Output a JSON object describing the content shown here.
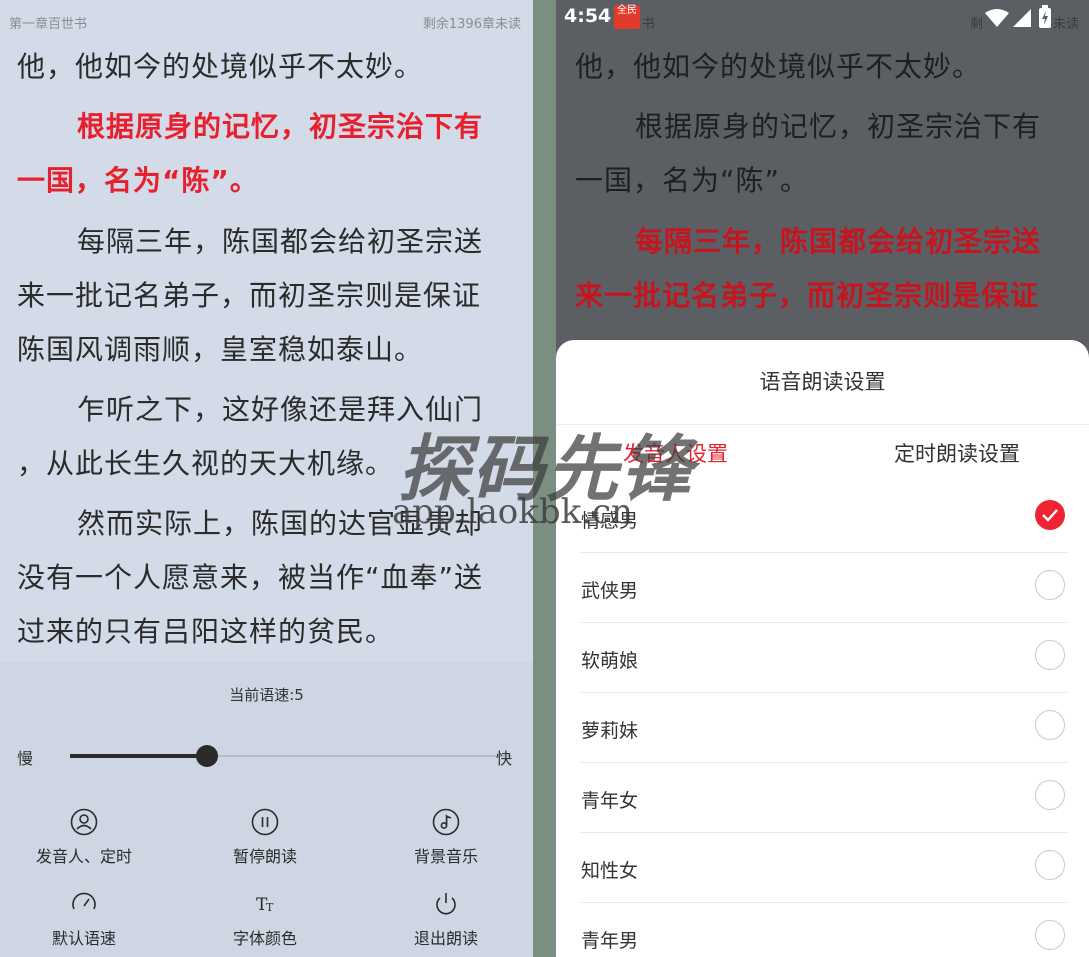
{
  "left": {
    "chapter_title": "第一章百世书",
    "remaining": "剩余1396章未读",
    "paragraphs": {
      "p1": "他，他如今的处境似乎不太妙。",
      "p2a": "根据原身的记忆，初圣宗治下有",
      "p2b": "一国，名为“陈”。",
      "p3a": "每隔三年，陈国都会给初圣宗送",
      "p3b": "来一批记名弟子，而初圣宗则是保证",
      "p3c": "陈国风调雨顺，皇室稳如泰山。",
      "p4a": "乍听之下，这好像还是拜入仙门",
      "p4b": "，从此长生久视的天大机缘。",
      "p5a": "然而实际上，陈国的达官显贵却",
      "p5b": "没有一个人愿意来，被当作“血奉”送",
      "p5c": "过来的只有吕阳这样的贫民。"
    },
    "speed": {
      "label": "当前语速:5",
      "value": 5,
      "fraction": 0.31,
      "slow": "慢",
      "fast": "快"
    },
    "controls": {
      "voice_timer": "发音人、定时",
      "pause": "暂停朗读",
      "bg_music": "背景音乐",
      "default_speed": "默认语速",
      "font_color": "字体颜色",
      "exit": "退出朗读"
    }
  },
  "right": {
    "status": {
      "time": "4:54",
      "app_badge": "全民",
      "partial_chapter": "书",
      "partial_remaining": "剩",
      "partial_unread": "未读"
    },
    "paragraphs": {
      "p1": "他，他如今的处境似乎不太妙。",
      "p2a": "根据原身的记忆，初圣宗治下有",
      "p2b": "一国，名为“陈”。",
      "p3a": "每隔三年，陈国都会给初圣宗送",
      "p3b": "来一批记名弟子，而初圣宗则是保证"
    },
    "sheet": {
      "title": "语音朗读设置",
      "tabs": {
        "voice": "发音人设置",
        "timer": "定时朗读设置"
      },
      "voices": [
        {
          "label": "情感男",
          "selected": true
        },
        {
          "label": "武侠男",
          "selected": false
        },
        {
          "label": "软萌娘",
          "selected": false
        },
        {
          "label": "萝莉妹",
          "selected": false
        },
        {
          "label": "青年女",
          "selected": false
        },
        {
          "label": "知性女",
          "selected": false
        },
        {
          "label": "青年男",
          "selected": false
        }
      ]
    }
  },
  "watermark": {
    "cn": "探码先锋",
    "url": "app.laokbk.cn"
  },
  "colors": {
    "accent": "#e8202e",
    "left_bg": "#d2dbe7",
    "right_overlay": "#5b5e63",
    "divider": "#7a8f7f"
  }
}
